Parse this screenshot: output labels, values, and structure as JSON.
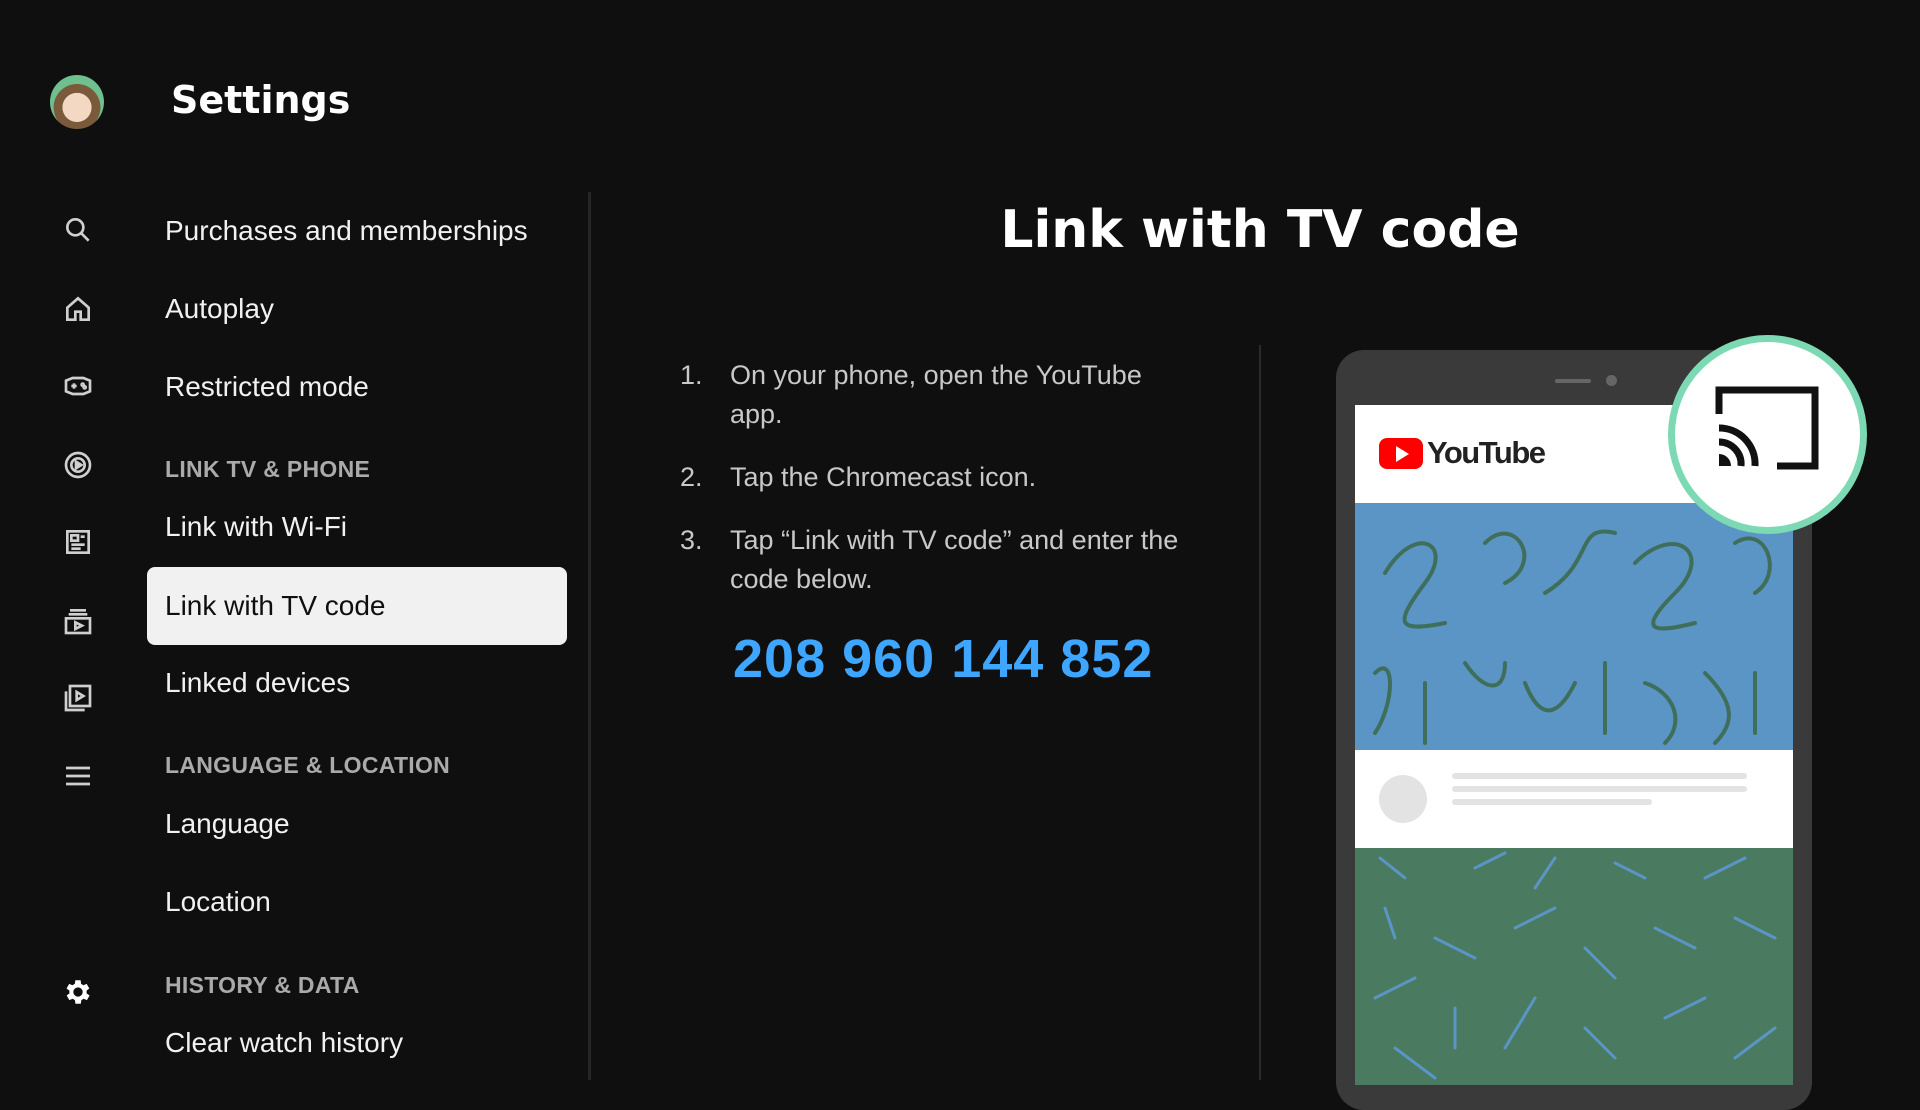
{
  "header": {
    "title": "Settings"
  },
  "rail": [
    "search-icon",
    "home-icon",
    "gaming-icon",
    "music-icon",
    "news-icon",
    "subscriptions-icon",
    "library-icon",
    "menu-icon",
    "settings-icon"
  ],
  "menu": {
    "items": [
      {
        "label": "Purchases and memberships"
      },
      {
        "label": "Autoplay"
      },
      {
        "label": "Restricted mode"
      },
      {
        "label": "Link with Wi-Fi"
      },
      {
        "label": "Link with TV code",
        "selected": true
      },
      {
        "label": "Linked devices"
      },
      {
        "label": "Language"
      },
      {
        "label": "Location"
      },
      {
        "label": "Clear watch history"
      }
    ],
    "sections": [
      "LINK TV & PHONE",
      "LANGUAGE & LOCATION",
      "HISTORY & DATA"
    ]
  },
  "content": {
    "title": "Link with TV code",
    "steps": [
      {
        "num": "1.",
        "text": "On your phone, open the YouTube app."
      },
      {
        "num": "2.",
        "text": "Tap the Chromecast icon."
      },
      {
        "num": "3.",
        "text": "Tap “Link with TV code” and enter the code below."
      }
    ],
    "code": "208 960 144 852"
  },
  "illustration": {
    "logo_text": "YouTube"
  },
  "colors": {
    "accent": "#3ea6ff",
    "background": "#0f0f0f",
    "cast_ring": "#7dd9b3",
    "youtube_red": "#ff0000"
  }
}
